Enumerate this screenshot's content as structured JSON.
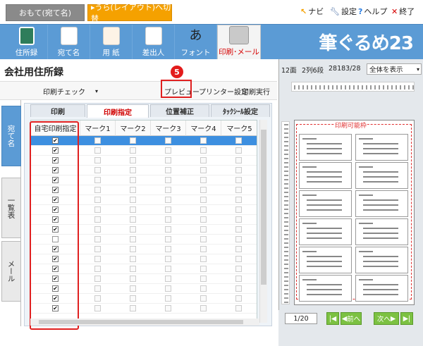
{
  "tabs": {
    "omote": "おもて(宛て名)",
    "ura": "▸うら(レイアウト)へ切替"
  },
  "top_menu": {
    "navi": "ナビ",
    "settings": "設定",
    "help": "ヘルプ",
    "exit": "終了"
  },
  "ribbon": {
    "items": [
      {
        "label": "住所録",
        "icon": "address-book-icon"
      },
      {
        "label": "宛て名",
        "icon": "postcard-icon"
      },
      {
        "label": "用 紙",
        "icon": "paper-icon"
      },
      {
        "label": "差出人",
        "icon": "sender-icon"
      },
      {
        "label": "フォント",
        "icon": "font-icon"
      },
      {
        "label": "印刷･メール",
        "icon": "printer-icon"
      }
    ],
    "brand": "筆ぐるめ23",
    "font_glyph": "あ"
  },
  "page_title": "会社用住所録",
  "badge": "5",
  "toolbar": {
    "print_check": "印刷チェック",
    "preview": "プレビュー",
    "printer_settings": "プリンター設定",
    "print_run": "印刷実行"
  },
  "side_tabs": {
    "atena": "宛て名",
    "ichiran": "一覧表",
    "mail": "メール"
  },
  "content_tabs": {
    "print": "印刷",
    "print_spec": "印刷指定",
    "position": "位置補正",
    "tack_seal": "ﾀｯｸｼｰﾙ設定"
  },
  "grid": {
    "columns": [
      "自宅印刷指定",
      "マーク1",
      "マーク2",
      "マーク3",
      "マーク4",
      "マーク5"
    ],
    "rows": [
      {
        "home": true,
        "selected": true
      },
      {
        "home": true
      },
      {
        "home": true
      },
      {
        "home": true
      },
      {
        "home": true
      },
      {
        "home": true
      },
      {
        "home": true
      },
      {
        "home": true
      },
      {
        "home": true
      },
      {
        "home": true
      },
      {
        "home": false
      },
      {
        "home": true
      },
      {
        "home": true
      },
      {
        "home": true
      },
      {
        "home": true
      },
      {
        "home": true
      },
      {
        "home": true
      },
      {
        "home": true
      }
    ]
  },
  "preview_info": {
    "count": "12面",
    "layout": "2列6段",
    "records": "28183/28",
    "zoom": "全体を表示"
  },
  "preview_area_label": "印刷可能枠",
  "pager": {
    "page": "1/20",
    "prev": "前へ",
    "next": "次へ"
  }
}
